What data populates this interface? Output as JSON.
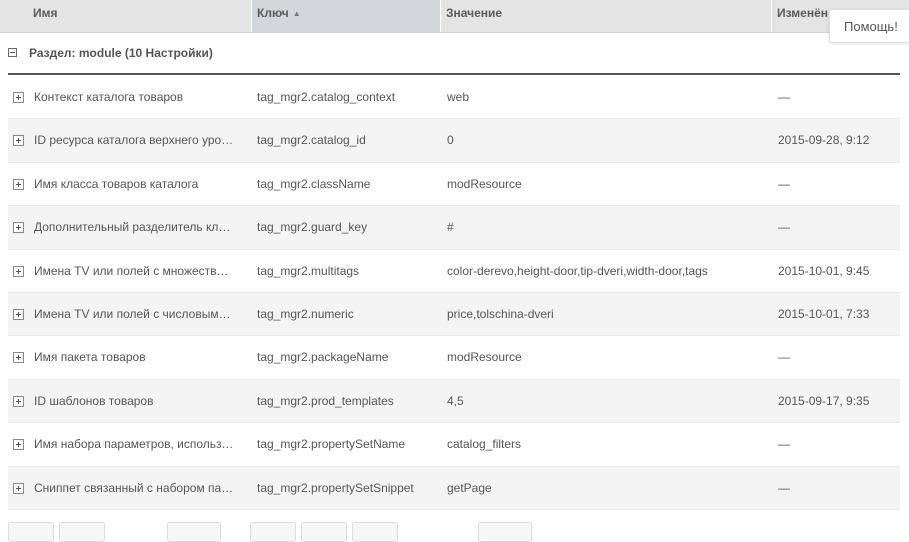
{
  "header": {
    "col_name": "Имя",
    "col_key": "Ключ",
    "col_value": "Значение",
    "col_edited": "Изменён",
    "sort_indicator": "▲"
  },
  "help_button": "Помощь!",
  "group": {
    "title": "Раздел: module (10 Настройки)"
  },
  "rows": [
    {
      "name": "Контекст каталога товаров",
      "key": "tag_mgr2.catalog_context",
      "value": "web",
      "edited": "—"
    },
    {
      "name": "ID ресурса каталога верхнего уровня",
      "key": "tag_mgr2.catalog_id",
      "value": "0",
      "edited": "2015-09-28, 9:12"
    },
    {
      "name": "Имя класса товаров каталога",
      "key": "tag_mgr2.className",
      "value": "modResource",
      "edited": "—"
    },
    {
      "name": "Дополнительный разделитель ключей",
      "key": "tag_mgr2.guard_key",
      "value": "#",
      "edited": "—"
    },
    {
      "name": "Имена TV или полей с множественными значениями",
      "key": "tag_mgr2.multitags",
      "value": "color-derevo,height-door,tip-dveri,width-door,tags",
      "edited": "2015-10-01, 9:45"
    },
    {
      "name": "Имена TV или полей с числовыми значениями",
      "key": "tag_mgr2.numeric",
      "value": "price,tolschina-dveri",
      "edited": "2015-10-01, 7:33"
    },
    {
      "name": "Имя пакета товаров",
      "key": "tag_mgr2.packageName",
      "value": "modResource",
      "edited": "—"
    },
    {
      "name": "ID шаблонов товаров",
      "key": "tag_mgr2.prod_templates",
      "value": "4,5",
      "edited": "2015-09-17, 9:35"
    },
    {
      "name": "Имя набора параметров, используемого",
      "key": "tag_mgr2.propertySetName",
      "value": "catalog_filters",
      "edited": "—"
    },
    {
      "name": "Сниппет связанный с набором параметров",
      "key": "tag_mgr2.propertySetSnippet",
      "value": "getPage",
      "edited": "—"
    }
  ]
}
